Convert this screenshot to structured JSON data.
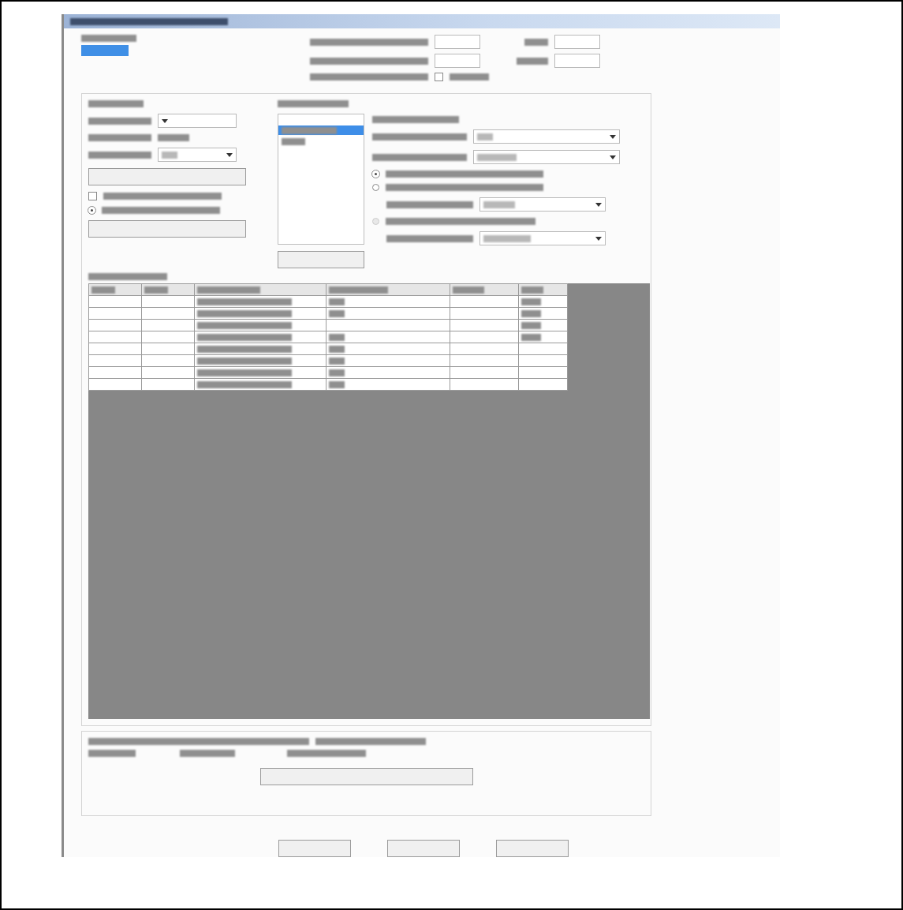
{
  "header_checkbox": {
    "checked": false
  },
  "left_options": [
    {
      "kind": "checkbox",
      "checked": false
    },
    {
      "kind": "radio",
      "checked": true
    }
  ],
  "right_options": [
    {
      "checked": true,
      "disabled": false
    },
    {
      "checked": false,
      "disabled": false
    },
    {
      "checked": false,
      "disabled": true
    }
  ],
  "list_items": [
    {
      "selected": true
    },
    {
      "selected": false
    }
  ]
}
